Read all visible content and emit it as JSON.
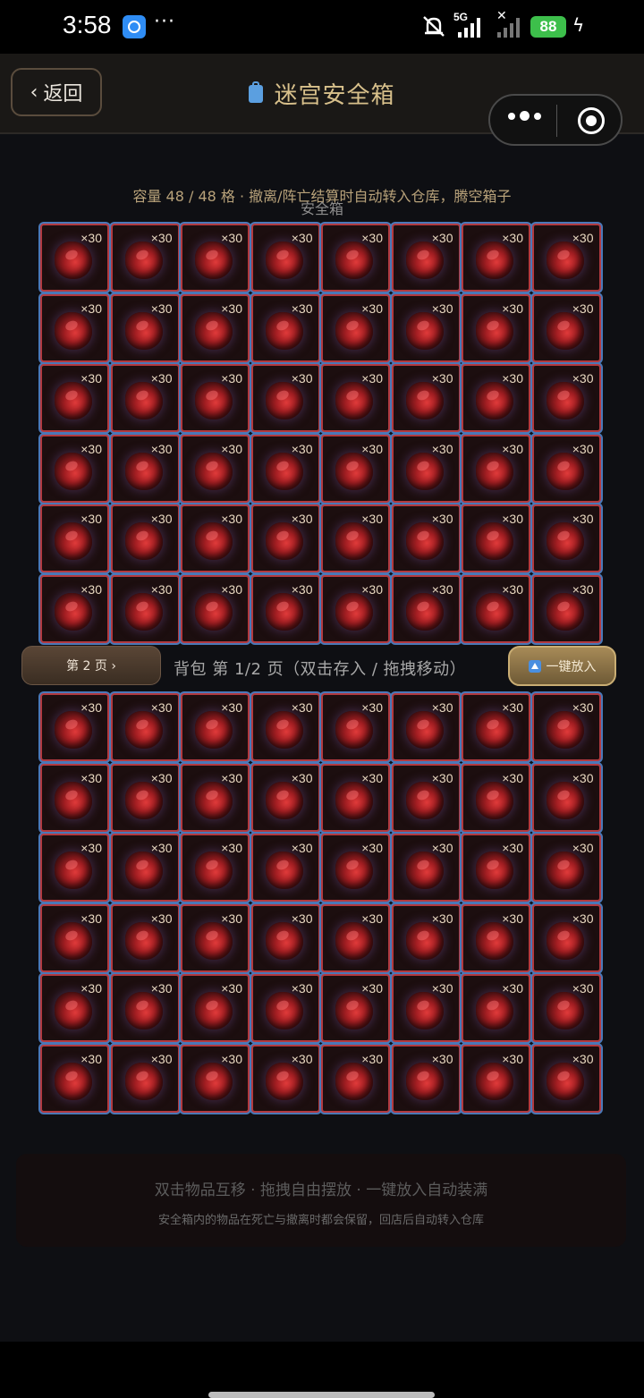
{
  "status_bar": {
    "time": "3:58",
    "dots": "···",
    "network": "5G",
    "battery": "88",
    "icons": [
      "app-badge-icon",
      "mute-icon",
      "signal-icon",
      "charging-icon"
    ]
  },
  "header": {
    "back_label": "返回",
    "back_chevron": "‹",
    "title": "迷宫安全箱"
  },
  "safe_box": {
    "capacity_text": "容量 48 / 48 格 · 撤离/阵亡结算时自动转入仓库，腾空箱子",
    "label": "安全箱",
    "slots": 48,
    "item_quantity": "×30"
  },
  "bag": {
    "next_page_label": "第 2 页 ›",
    "label": "背包 第 1/2 页（双击存入 / 拖拽移动）",
    "fill_all_label": "一键放入",
    "slots": 48,
    "item_quantity": "×30"
  },
  "tips": {
    "line1": "双击物品互移 · 拖拽自由摆放 · 一键放入自动装满",
    "line2": "安全箱内的物品在死亡与撤离时都会保留，回店后自动转入仓库"
  },
  "colors": {
    "slot_border": "#b23a40",
    "slot_glow": "#4a78b8",
    "title_gold": "#d8c08b",
    "background": "#0e0f13"
  }
}
